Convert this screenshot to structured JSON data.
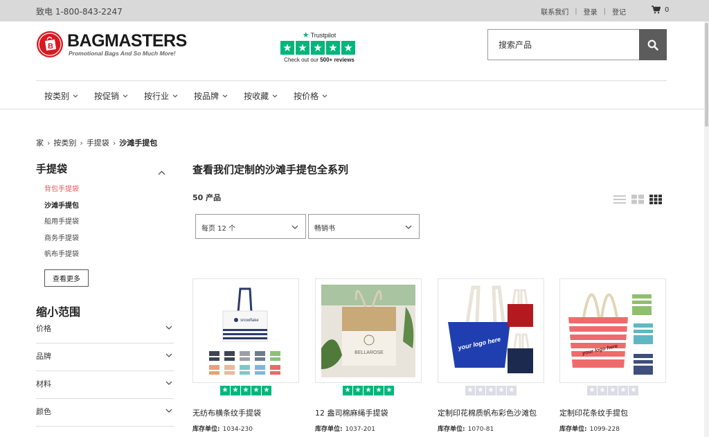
{
  "topbar": {
    "phone": "致电 1-800-843-2247",
    "contact": "联系我们",
    "login": "登录",
    "register": "登记",
    "cart_count": "0"
  },
  "logo": {
    "name": "BAGMASTERS",
    "tagline": "Promotional Bags And So Much More!"
  },
  "trustpilot": {
    "brand": "Trustpilot",
    "note_prefix": "Check out our ",
    "note_bold": "500+ reviews"
  },
  "search": {
    "placeholder": "搜索产品"
  },
  "nav": [
    "按类别",
    "按促销",
    "按行业",
    "按品牌",
    "按收藏",
    "按价格"
  ],
  "breadcrumb": {
    "home": "家",
    "cat": "按类别",
    "sub": "手提袋",
    "current": "沙滩手提包"
  },
  "sidebar": {
    "title": "手提袋",
    "items": [
      {
        "label": "背包手提袋",
        "state": "active"
      },
      {
        "label": "沙滩手提包",
        "state": "current"
      },
      {
        "label": "船用手提袋",
        "state": ""
      },
      {
        "label": "商务手提袋",
        "state": ""
      },
      {
        "label": "帆布手提袋",
        "state": ""
      }
    ],
    "see_more": "查看更多",
    "narrow_title": "缩小范围",
    "filters": [
      "价格",
      "品牌",
      "材料",
      "颜色"
    ]
  },
  "main": {
    "title": "查看我们定制的沙滩手提包全系列",
    "count": "50 产品",
    "per_page": "每页 12 个",
    "sort": "畅销书"
  },
  "products": [
    {
      "name": "无纺布横条纹手提袋",
      "sku_label": "库存单位:",
      "sku": "1034-230",
      "rated": true
    },
    {
      "name": "12 盎司棉麻绳手提袋",
      "sku_label": "库存单位:",
      "sku": "1037-201",
      "rated": true
    },
    {
      "name": "定制印花棉质帆布彩色沙滩包",
      "sku_label": "库存单位:",
      "sku": "1070-81",
      "rated": false
    },
    {
      "name": "定制印花条纹手提包",
      "sku_label": "库存单位:",
      "sku": "1099-228",
      "rated": false
    }
  ],
  "image_text": {
    "p1_brand": "snowflake",
    "p2_brand": "BELLAROSE",
    "p3_logo": "your logo here",
    "p4_logo": "your logo here"
  },
  "colors": {
    "trustpilot_green": "#00b67a",
    "logo_red": "#d71920",
    "sidebar_active": "#e5595b",
    "search_button": "#5c5c5c"
  }
}
